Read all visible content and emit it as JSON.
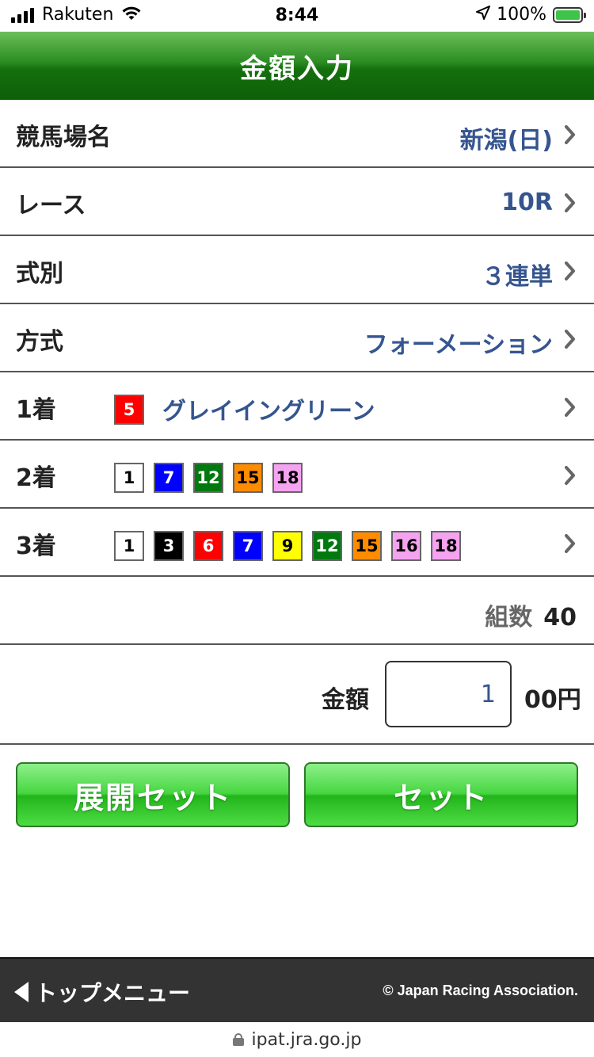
{
  "status_bar": {
    "carrier": "Rakuten",
    "time": "8:44",
    "battery": "100%",
    "battery_level": 1.0
  },
  "header": {
    "title": "金額入力"
  },
  "rows": {
    "racecourse": {
      "label": "競馬場名",
      "value": "新潟(日)"
    },
    "race": {
      "label": "レース",
      "value": "10R"
    },
    "bet_type": {
      "label": "式別",
      "value": "３連単"
    },
    "method": {
      "label": "方式",
      "value": "フォーメーション"
    },
    "first": {
      "label": "1着",
      "horses": [
        {
          "number": "5",
          "bg": "#ff0000",
          "fg": "#ffffff"
        }
      ],
      "horse_name": "グレイイングリーン"
    },
    "second": {
      "label": "2着",
      "horses": [
        {
          "number": "1",
          "bg": "#ffffff",
          "fg": "#000000"
        },
        {
          "number": "7",
          "bg": "#0000ff",
          "fg": "#ffffff"
        },
        {
          "number": "12",
          "bg": "#007a0f",
          "fg": "#ffffff"
        },
        {
          "number": "15",
          "bg": "#ff8c00",
          "fg": "#000000"
        },
        {
          "number": "18",
          "bg": "#f5a3f0",
          "fg": "#000000"
        }
      ]
    },
    "third": {
      "label": "3着",
      "horses": [
        {
          "number": "1",
          "bg": "#ffffff",
          "fg": "#000000"
        },
        {
          "number": "3",
          "bg": "#000000",
          "fg": "#ffffff"
        },
        {
          "number": "6",
          "bg": "#ff0000",
          "fg": "#ffffff"
        },
        {
          "number": "7",
          "bg": "#0000ff",
          "fg": "#ffffff"
        },
        {
          "number": "9",
          "bg": "#ffff00",
          "fg": "#000000"
        },
        {
          "number": "12",
          "bg": "#007a0f",
          "fg": "#ffffff"
        },
        {
          "number": "15",
          "bg": "#ff8c00",
          "fg": "#000000"
        },
        {
          "number": "16",
          "bg": "#f5a3f0",
          "fg": "#000000"
        },
        {
          "number": "18",
          "bg": "#f5a3f0",
          "fg": "#000000"
        }
      ]
    }
  },
  "combinations": {
    "label": "組数",
    "value": "40"
  },
  "amount": {
    "label": "金額",
    "value": "1",
    "unit": "00円"
  },
  "buttons": {
    "expand_set": "展開セット",
    "set": "セット"
  },
  "footer": {
    "menu_label": "トップメニュー",
    "copyright": "© Japan Racing Association."
  },
  "url": "ipat.jra.go.jp",
  "colors": {
    "header_green": "#15700e",
    "value_blue": "#35558f",
    "button_green": "#2fc428"
  }
}
